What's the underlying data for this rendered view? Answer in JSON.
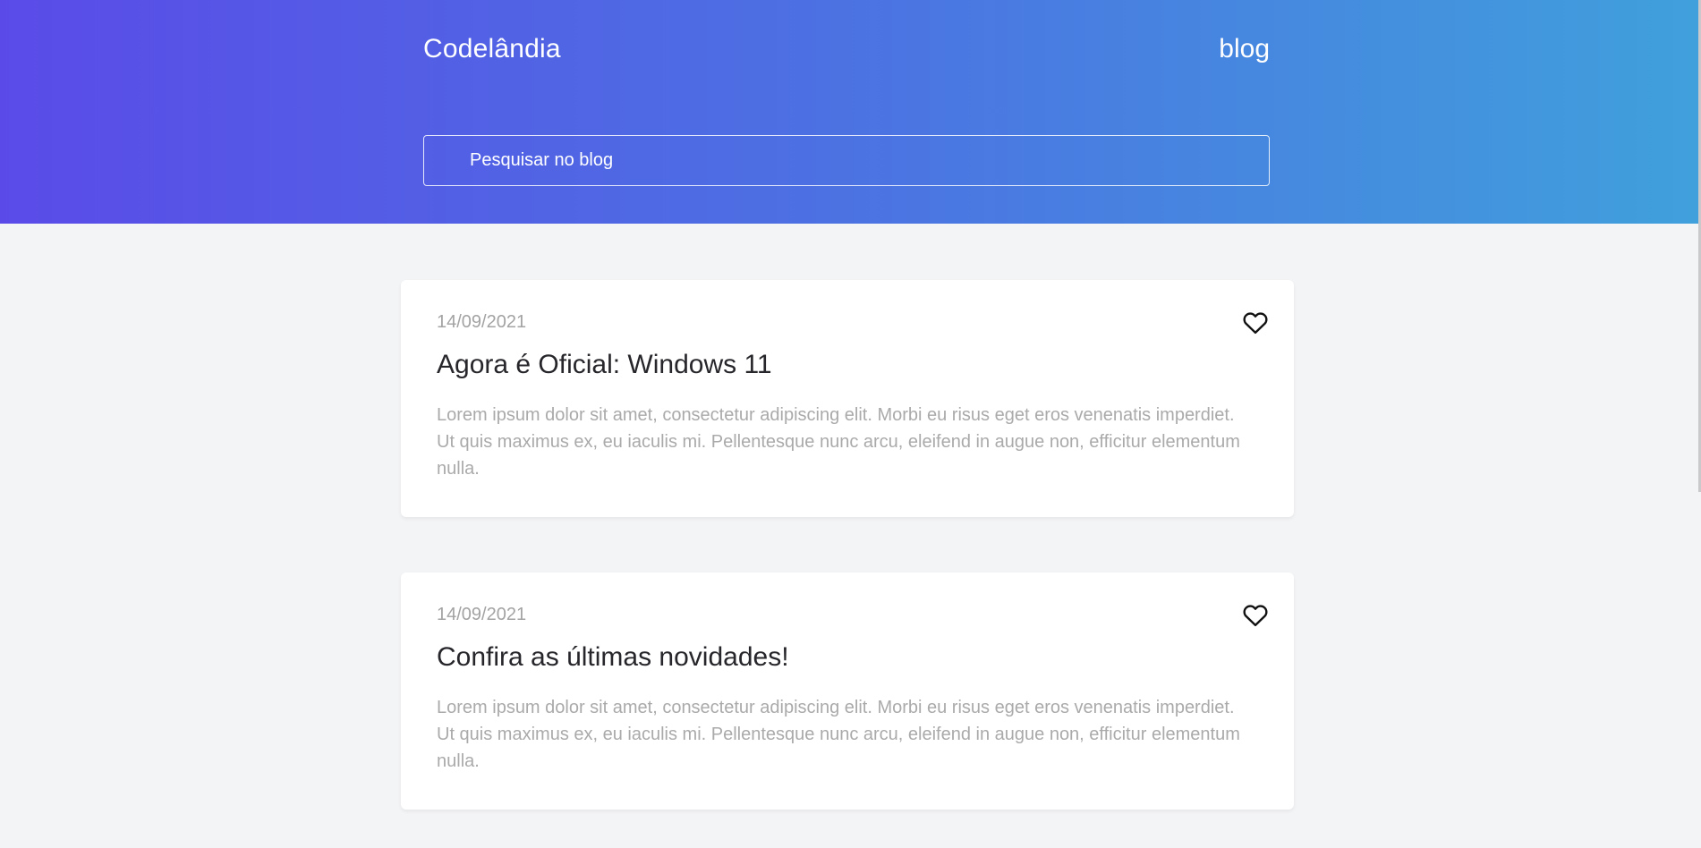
{
  "header": {
    "brand": "Codelândia",
    "nav_link": "blog",
    "search_placeholder": "Pesquisar no blog"
  },
  "posts": [
    {
      "date": "14/09/2021",
      "title": "Agora é Oficial: Windows 11",
      "excerpt": "Lorem ipsum dolor sit amet, consectetur adipiscing elit. Morbi eu risus eget eros venenatis imperdiet. Ut quis maximus ex, eu iaculis mi. Pellentesque nunc arcu, eleifend in augue non, efficitur elementum nulla.",
      "icon": "heart-icon"
    },
    {
      "date": "14/09/2021",
      "title": "Confira as últimas novidades!",
      "excerpt": "Lorem ipsum dolor sit amet, consectetur adipiscing elit. Morbi eu risus eget eros venenatis imperdiet. Ut quis maximus ex, eu iaculis mi. Pellentesque nunc arcu, eleifend in augue non, efficitur elementum nulla.",
      "icon": "heart-icon"
    }
  ],
  "colors": {
    "gradient_start": "#5a4be8",
    "gradient_end": "#40a0dc",
    "page_background": "#f3f4f6",
    "card_background": "#ffffff",
    "title_text": "#26262b",
    "muted_text": "#a3a3a3"
  }
}
